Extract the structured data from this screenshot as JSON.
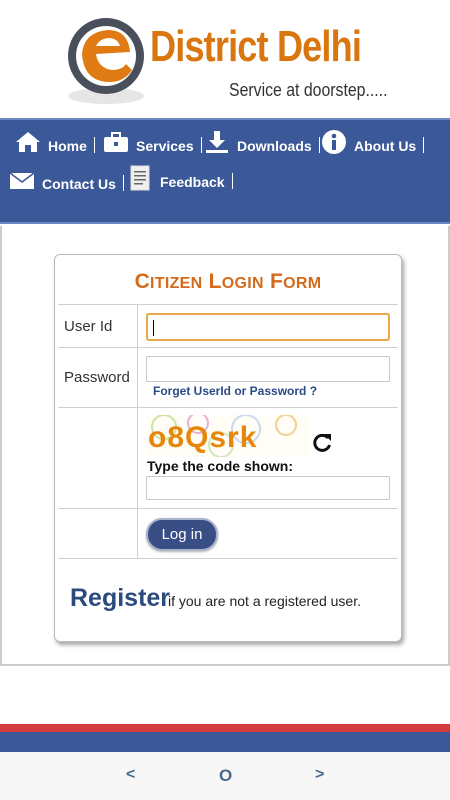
{
  "header": {
    "brand_title": "District Delhi",
    "tagline": "Service at doorstep....."
  },
  "nav": {
    "items": [
      {
        "label": "Home",
        "icon": "home-icon"
      },
      {
        "label": "Services",
        "icon": "briefcase-icon"
      },
      {
        "label": "Downloads",
        "icon": "download-icon"
      },
      {
        "label": "About Us",
        "icon": "info-icon"
      },
      {
        "label": "Contact Us",
        "icon": "mail-icon"
      },
      {
        "label": "Feedback",
        "icon": "document-icon"
      }
    ]
  },
  "form": {
    "title_big_1": "C",
    "title_small_1": "ITIZEN",
    "title_big_2": "L",
    "title_small_2": "OGIN",
    "title_big_3": "F",
    "title_small_3": "ORM",
    "user_id_label": "User Id",
    "user_id_value": "",
    "password_label": "Password",
    "password_value": "",
    "forgot_link": "Forget UserId or Password ?",
    "captcha_text": "o8Qsrk",
    "captcha_prompt": "Type the code shown:",
    "captcha_value": "",
    "login_button": "Log in",
    "register_link": "Register",
    "register_text": "if you are not a registered user."
  },
  "bottom_nav": {
    "back": "<",
    "home": "O",
    "forward": ">"
  },
  "colors": {
    "brand_orange": "#d9760f",
    "nav_blue": "#3b5998",
    "title_orange": "#d46a1c",
    "register_blue": "#2b4a7e",
    "footer_red": "#d33d3d"
  }
}
